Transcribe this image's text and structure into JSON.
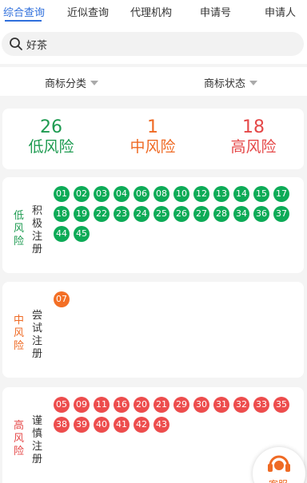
{
  "tabs": [
    {
      "label": "综合查询",
      "active": true
    },
    {
      "label": "近似查询"
    },
    {
      "label": "代理机构"
    },
    {
      "label": "申请号"
    },
    {
      "label": "申请人"
    }
  ],
  "search": {
    "value": "好茶"
  },
  "filters": [
    {
      "label": "商标分类"
    },
    {
      "label": "商标状态"
    }
  ],
  "summary": [
    {
      "count": "26",
      "label": "低风险",
      "color": "#1e9b51"
    },
    {
      "count": "1",
      "label": "中风险",
      "color": "#ef6a24"
    },
    {
      "count": "18",
      "label": "高风险",
      "color": "#e54848"
    }
  ],
  "risk_groups": [
    {
      "level": "低风险",
      "action": "积极注册",
      "color": "#1e9b51",
      "chip_color": "#0dab57",
      "classes": [
        "01",
        "02",
        "03",
        "04",
        "06",
        "08",
        "10",
        "12",
        "13",
        "14",
        "15",
        "17",
        "18",
        "19",
        "22",
        "23",
        "24",
        "25",
        "26",
        "27",
        "28",
        "34",
        "36",
        "37",
        "44",
        "45"
      ]
    },
    {
      "level": "中风险",
      "action": "尝试注册",
      "color": "#ef6a24",
      "chip_color": "#f36f25",
      "classes": [
        "07"
      ]
    },
    {
      "level": "高风险",
      "action": "谨慎注册",
      "color": "#e54848",
      "chip_color": "#ed4d4d",
      "classes": [
        "05",
        "09",
        "11",
        "16",
        "20",
        "21",
        "29",
        "30",
        "31",
        "32",
        "33",
        "35",
        "38",
        "39",
        "40",
        "41",
        "42",
        "43"
      ]
    }
  ],
  "fab": {
    "label": "客服",
    "icon": "headset-icon"
  }
}
